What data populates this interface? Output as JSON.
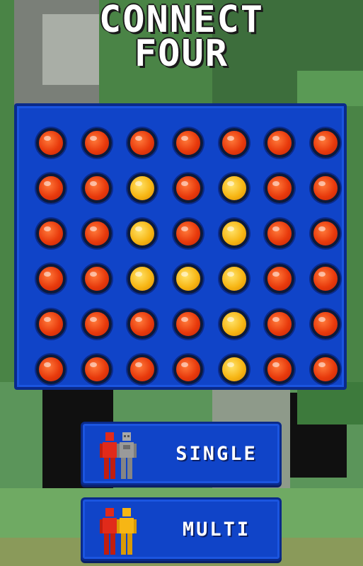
{
  "title": {
    "line1": "CONNECT",
    "line2": "FOUR"
  },
  "board": {
    "rows": [
      [
        "red",
        "red",
        "red",
        "red",
        "red",
        "red",
        "red"
      ],
      [
        "red",
        "red",
        "yellow",
        "red",
        "yellow",
        "red",
        "red"
      ],
      [
        "red",
        "red",
        "yellow",
        "red",
        "yellow",
        "red",
        "red"
      ],
      [
        "red",
        "red",
        "yellow",
        "yellow",
        "yellow",
        "red",
        "red"
      ],
      [
        "red",
        "red",
        "red",
        "red",
        "yellow",
        "red",
        "red"
      ],
      [
        "red",
        "red",
        "red",
        "red",
        "yellow",
        "red",
        "red"
      ]
    ]
  },
  "buttons": {
    "single": {
      "label": "SINGLE",
      "icon": "single-player-icon"
    },
    "multi": {
      "label": "MULTI",
      "icon": "multi-player-icon"
    }
  },
  "colors": {
    "board": "#1044c8",
    "red_disc": "#e83a0c",
    "yellow_disc": "#f7b614"
  }
}
